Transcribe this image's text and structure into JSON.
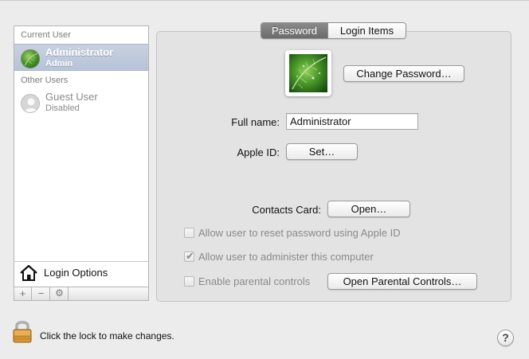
{
  "sidebar": {
    "current_user_header": "Current User",
    "other_users_header": "Other Users",
    "current_user": {
      "name": "Administrator",
      "role": "Admin"
    },
    "other_users": [
      {
        "name": "Guest User",
        "role": "Disabled"
      }
    ],
    "login_options_label": "Login Options",
    "toolbar": {
      "add": "+",
      "remove": "−",
      "action": "⚙"
    }
  },
  "tabs": [
    {
      "label": "Password",
      "selected": true
    },
    {
      "label": "Login Items",
      "selected": false
    }
  ],
  "password_pane": {
    "change_password_button": "Change Password…",
    "full_name_label": "Full name:",
    "full_name_value": "Administrator",
    "apple_id_label": "Apple ID:",
    "apple_id_button": "Set…",
    "contacts_card_label": "Contacts Card:",
    "contacts_card_button": "Open…",
    "checkboxes": [
      {
        "label": "Allow user to reset password using Apple ID",
        "checked": false,
        "enabled": false
      },
      {
        "label": "Allow user to administer this computer",
        "checked": true,
        "enabled": false
      },
      {
        "label": "Enable parental controls",
        "checked": false,
        "enabled": false
      }
    ],
    "open_parental_controls_button": "Open Parental Controls…"
  },
  "footer": {
    "lock_label": "Click the lock to make changes.",
    "help_label": "?"
  },
  "colors": {
    "window_bg": "#ececec",
    "selection": "#b7c3d8",
    "selected_tab": "#6b6b6b",
    "disabled_text": "#8a8a8a"
  },
  "icons": {
    "current_user_avatar": "leaf-avatar-icon",
    "guest_avatar": "guest-silhouette-icon",
    "login_options": "house-icon",
    "lock": "lock-icon",
    "help": "help-icon",
    "action": "gear-icon"
  }
}
